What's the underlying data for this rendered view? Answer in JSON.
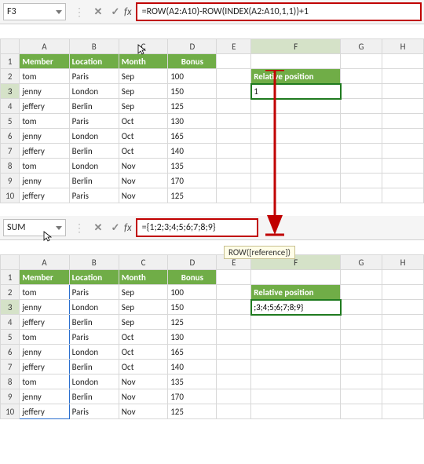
{
  "top": {
    "name_box": "F3",
    "formula": "=ROW(A2:A10)-ROW(INDEX(A2:A10,1,1))+1"
  },
  "cols": [
    "A",
    "B",
    "C",
    "D",
    "E",
    "F",
    "G",
    "H"
  ],
  "headers": {
    "member": "Member",
    "location": "Location",
    "month": "Month",
    "bonus": "Bonus",
    "relpos": "Relative position"
  },
  "rows1": [
    {
      "n": "1"
    },
    {
      "n": "2",
      "a": "tom",
      "b": "Paris",
      "c": "Sep",
      "d": "100"
    },
    {
      "n": "3",
      "a": "jenny",
      "b": "London",
      "c": "Sep",
      "d": "150",
      "f": "1"
    },
    {
      "n": "4",
      "a": "jeffery",
      "b": "Berlin",
      "c": "Sep",
      "d": "125"
    },
    {
      "n": "5",
      "a": "tom",
      "b": "Paris",
      "c": "Oct",
      "d": "130"
    },
    {
      "n": "6",
      "a": "jenny",
      "b": "London",
      "c": "Oct",
      "d": "165"
    },
    {
      "n": "7",
      "a": "jeffery",
      "b": "Berlin",
      "c": "Oct",
      "d": "140"
    },
    {
      "n": "8",
      "a": "tom",
      "b": "London",
      "c": "Nov",
      "d": "135"
    },
    {
      "n": "9",
      "a": "jenny",
      "b": "Berlin",
      "c": "Nov",
      "d": "170"
    },
    {
      "n": "10",
      "a": "jeffery",
      "b": "Paris",
      "c": "Nov",
      "d": "125"
    }
  ],
  "bottom": {
    "name_box": "SUM",
    "formula": "={1;2;3;4;5;6;7;8;9}",
    "tooltip": "ROW([reference])"
  },
  "rows2": [
    {
      "n": "1"
    },
    {
      "n": "2",
      "a": "tom",
      "b": "Paris",
      "c": "Sep",
      "d": "100"
    },
    {
      "n": "3",
      "a": "jenny",
      "b": "London",
      "c": "Sep",
      "d": "150",
      "f": ";3;4;5;6;7;8;9}"
    },
    {
      "n": "4",
      "a": "jeffery",
      "b": "Berlin",
      "c": "Sep",
      "d": "125"
    },
    {
      "n": "5",
      "a": "tom",
      "b": "Paris",
      "c": "Oct",
      "d": "130"
    },
    {
      "n": "6",
      "a": "jenny",
      "b": "London",
      "c": "Oct",
      "d": "165"
    },
    {
      "n": "7",
      "a": "jeffery",
      "b": "Berlin",
      "c": "Oct",
      "d": "140"
    },
    {
      "n": "8",
      "a": "tom",
      "b": "London",
      "c": "Nov",
      "d": "135"
    },
    {
      "n": "9",
      "a": "jenny",
      "b": "Berlin",
      "c": "Nov",
      "d": "170"
    },
    {
      "n": "10",
      "a": "jeffery",
      "b": "Paris",
      "c": "Nov",
      "d": "125"
    }
  ],
  "chart_data": {
    "type": "table",
    "title": "",
    "columns": [
      "Member",
      "Location",
      "Month",
      "Bonus"
    ],
    "rows": [
      [
        "tom",
        "Paris",
        "Sep",
        100
      ],
      [
        "jenny",
        "London",
        "Sep",
        150
      ],
      [
        "jeffery",
        "Berlin",
        "Sep",
        125
      ],
      [
        "tom",
        "Paris",
        "Oct",
        130
      ],
      [
        "jenny",
        "London",
        "Oct",
        165
      ],
      [
        "jeffery",
        "Berlin",
        "Oct",
        140
      ],
      [
        "tom",
        "London",
        "Nov",
        135
      ],
      [
        "jenny",
        "Berlin",
        "Nov",
        170
      ],
      [
        "jeffery",
        "Paris",
        "Nov",
        125
      ]
    ]
  }
}
